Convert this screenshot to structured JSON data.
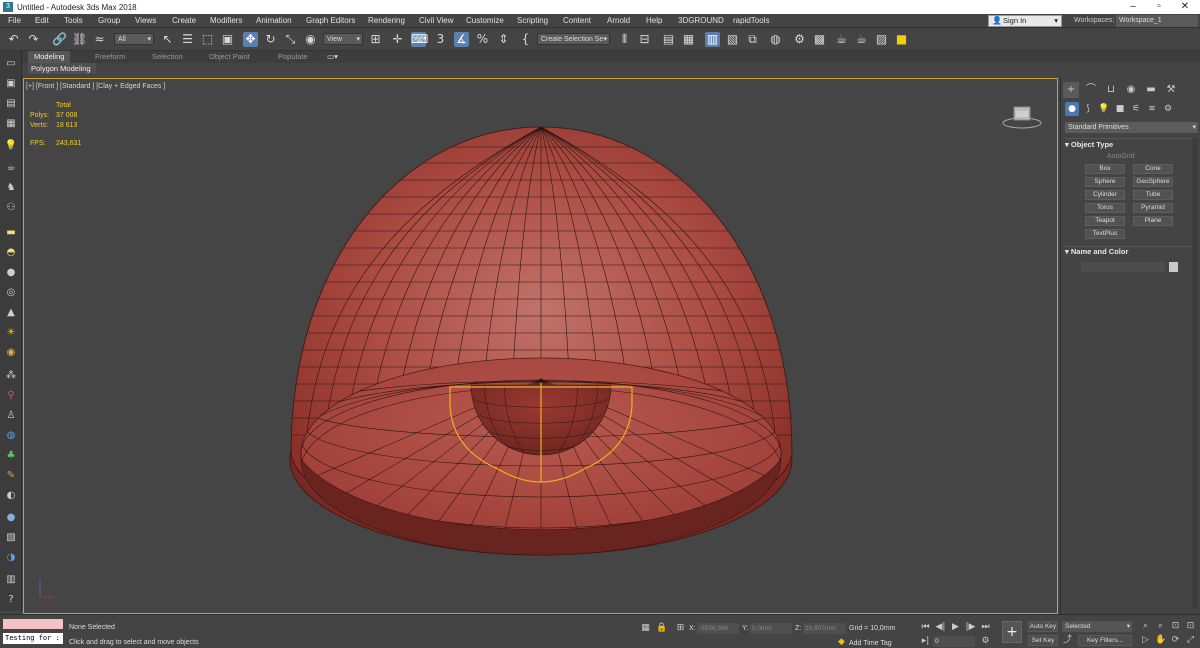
{
  "window": {
    "title": "Untitled - Autodesk 3ds Max 2018"
  },
  "menu": {
    "items": [
      "File",
      "Edit",
      "Tools",
      "Group",
      "Views",
      "Create",
      "Modifiers",
      "Animation",
      "Graph Editors",
      "Rendering",
      "Civil View",
      "Customize",
      "Scripting",
      "Content",
      "Arnold",
      "Help",
      "3DGROUND",
      "rapidTools"
    ],
    "sign_in": "Sign In",
    "workspaces_label": "Workspaces:",
    "workspace_value": "Workspace_1"
  },
  "toolbar": {
    "filter_value": "All",
    "ref_coord_value": "View",
    "selection_set_value": "Create Selection Se"
  },
  "ribbon": {
    "tabs": [
      "Modeling",
      "Freeform",
      "Selection",
      "Object Paint",
      "Populate"
    ],
    "active_tab": "Modeling",
    "sub_label": "Polygon Modeling"
  },
  "viewport": {
    "label": "[+] [Front ] [Standard ] [Clay + Edged Faces ]",
    "stats": {
      "total_label": "Total",
      "polys_label": "Polys:",
      "polys_value": "37 008",
      "verts_label": "Verts:",
      "verts_value": "18 613",
      "fps_label": "FPS:",
      "fps_value": "243,631"
    },
    "colors": {
      "mesh": "#b04a42",
      "wire": "#2a1512",
      "selection": "#f0b020",
      "border": "#c6a33a"
    }
  },
  "command_panel": {
    "primitive_dropdown": "Standard Primitives",
    "object_type_title": "Object Type",
    "autogrid_label": "AutoGrid",
    "buttons": [
      "Box",
      "Cone",
      "Sphere",
      "GeoSphere",
      "Cylinder",
      "Tube",
      "Torus",
      "Pyramid",
      "Teapot",
      "Plane",
      "TextPlus"
    ],
    "name_color_title": "Name and Color"
  },
  "status": {
    "maxscript_text": "Testing for :",
    "selection_status": "None Selected",
    "prompt": "Click and drag to select and move objects",
    "x_label": "X:",
    "x_value": "-5536,386",
    "y_label": "Y:",
    "y_value": "0,0mm",
    "z_label": "Z:",
    "z_value": "20,807mm",
    "grid": "Grid = 10,0mm",
    "add_time_tag": "Add Time Tag",
    "frame_value": "0",
    "auto_key": "Auto Key",
    "set_key": "Set Key",
    "selected_dropdown": "Selected",
    "key_filters": "Key Filters..."
  }
}
